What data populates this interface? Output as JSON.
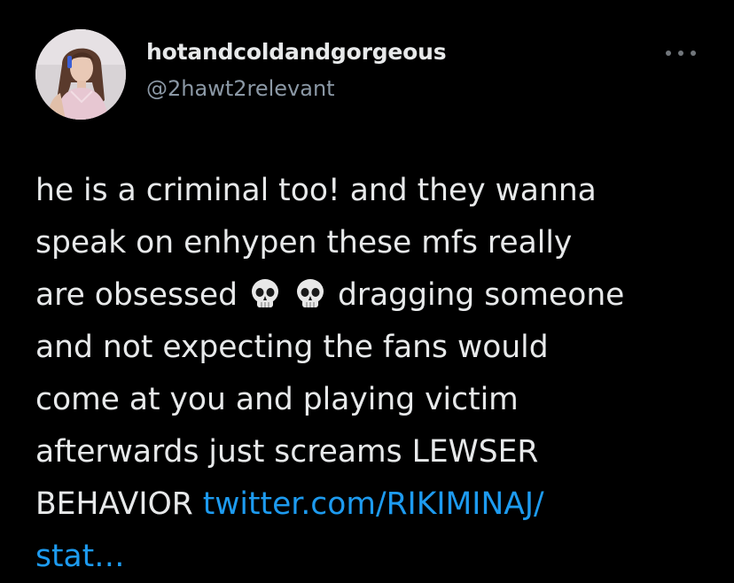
{
  "tweet": {
    "display_name": "hotandcoldandgorgeous",
    "handle": "@2hawt2relevant",
    "lines": {
      "l1": "he is a criminal too! and they wanna",
      "l2": "speak on enhypen these mfs really",
      "l3_a": "are obsessed",
      "l3_b": "dragging someone",
      "l4": "and not expecting the fans would",
      "l5": "come at you and playing victim",
      "l6": "afterwards just screams LEWSER",
      "l7_a": "BEHAVIOR"
    },
    "link_part1": "twitter.com/RIKIMINAJ/",
    "link_part2": "stat…",
    "emoji": [
      "skull-emoji",
      "skull-emoji"
    ]
  },
  "icons": {
    "more": "more-horizontal-icon",
    "avatar": "profile-photo"
  },
  "colors": {
    "background": "#000000",
    "text": "#e7e9ea",
    "secondary": "#8b98a5",
    "link": "#1d9bf0"
  }
}
